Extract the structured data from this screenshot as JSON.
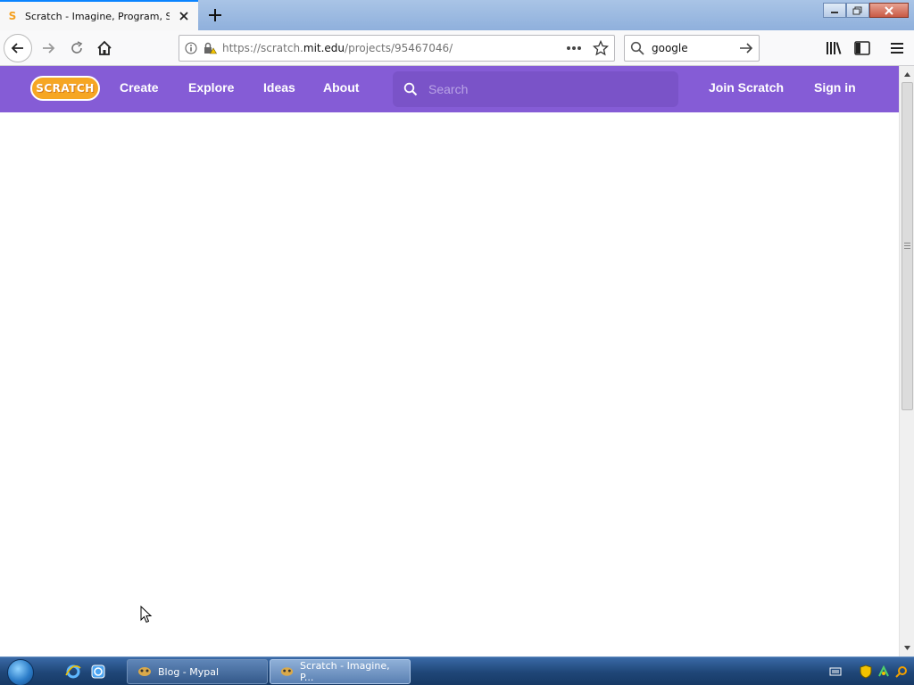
{
  "window": {
    "tab_title": "Scratch - Imagine, Program, Share",
    "favicon": "scratch-favicon",
    "newtab_icon": "plus-icon"
  },
  "toolbar": {
    "url_prefix": "https://scratch.",
    "url_host": "mit.edu",
    "url_path": "/projects/95467046/",
    "search_value": "google",
    "icons": [
      "back-icon",
      "forward-icon",
      "reload-icon",
      "home-icon",
      "info-icon",
      "lock-warning-icon",
      "more-icon",
      "star-icon",
      "search-icon",
      "go-arrow-icon",
      "library-icon",
      "sidebar-icon",
      "hamburger-icon"
    ]
  },
  "scratch": {
    "logo": "SCRATCH",
    "nav": [
      "Create",
      "Explore",
      "Ideas",
      "About"
    ],
    "search_placeholder": "Search",
    "join": "Join Scratch",
    "signin": "Sign in",
    "brand_color": "#855cd6"
  },
  "taskbar": {
    "tasks": [
      {
        "label": "Blog - Mypal"
      },
      {
        "label": "Scratch - Imagine, P..."
      }
    ]
  }
}
